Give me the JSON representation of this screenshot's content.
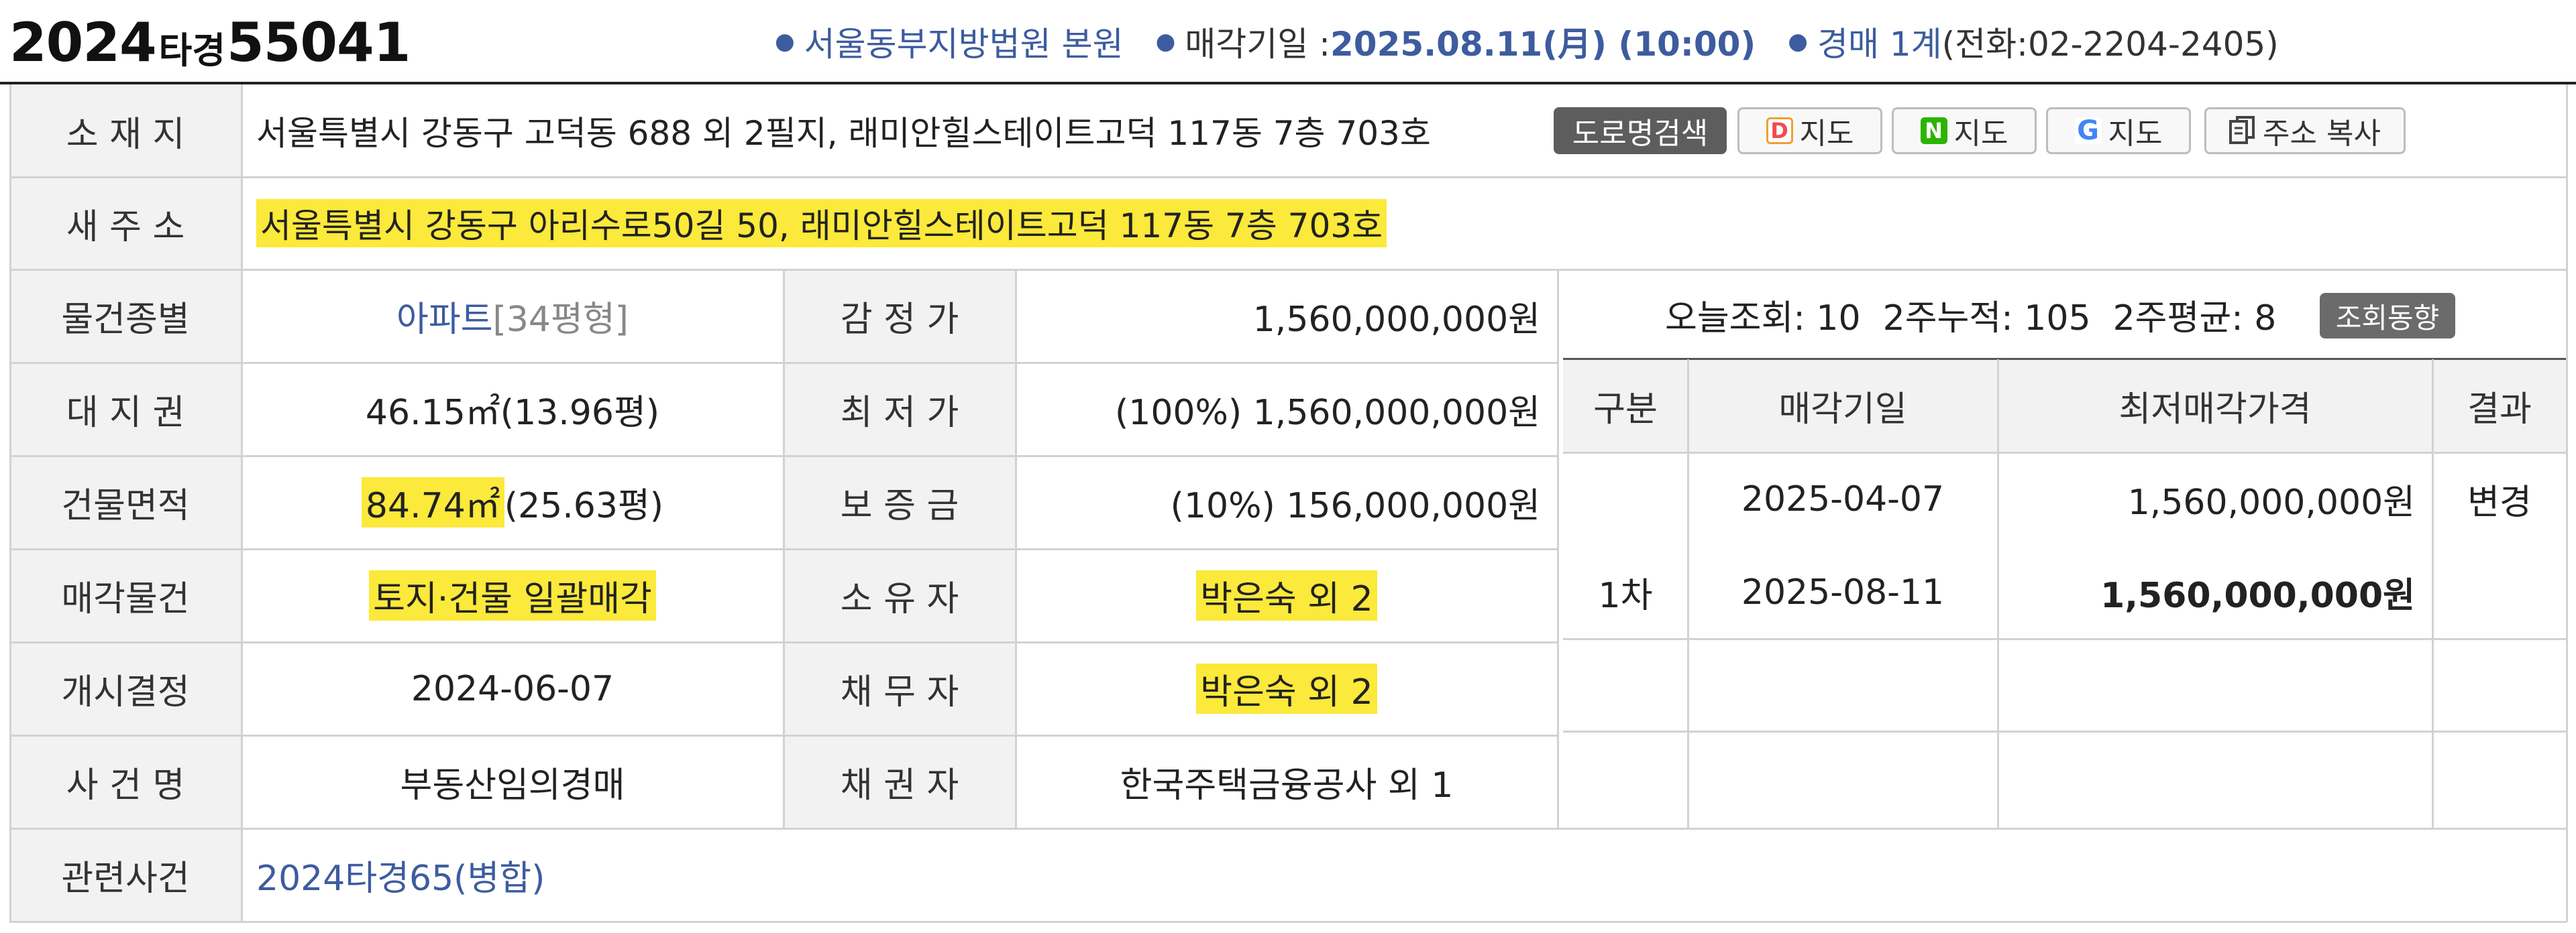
{
  "header": {
    "case_year": "2024",
    "case_type": "타경",
    "case_num": "55041",
    "court": "서울동부지방법원 본원",
    "sale_label": "매각기일 : ",
    "sale_date": "2025.08.11(月) (10:00)",
    "dept": "경매 1계",
    "phone": "(전화:02-2204-2405)"
  },
  "address": {
    "label": "소 재 지",
    "value": "서울특별시 강동구 고덕동 688 외 2필지, 래미안힐스테이트고덕 117동 7층 703호",
    "buttons": {
      "road": "도로명검색",
      "daum_icon": "D",
      "naver_icon": "N",
      "google_icon": "G",
      "map": "지도",
      "copy": "주소 복사"
    }
  },
  "new_address": {
    "label": "새 주 소",
    "value": "서울특별시 강동구 아리수로50길 50, 래미안힐스테이트고덕 117동 7층 703호"
  },
  "details": {
    "type_label": "물건종별",
    "type_value": "아파트",
    "type_size": "[34평형]",
    "land_label": "대 지 권",
    "land_value": "46.15㎡(13.96평)",
    "bldg_label": "건물면적",
    "bldg_value_hl": "84.74㎡",
    "bldg_value_rest": "(25.63평)",
    "sale_obj_label": "매각물건",
    "sale_obj_value": "토지·건물 일괄매각",
    "start_label": "개시결정",
    "start_value": "2024-06-07",
    "case_name_label": "사 건 명",
    "case_name_value": "부동산임의경매",
    "related_label": "관련사건",
    "related_value": "2024타경65(병합)"
  },
  "prices": {
    "appraisal_label": "감 정 가",
    "appraisal_value": "1,560,000,000원",
    "min_label": "최 저 가",
    "min_value": "(100%) 1,560,000,000원",
    "deposit_label": "보 증 금",
    "deposit_value": "(10%) 156,000,000원",
    "owner_label": "소 유 자",
    "owner_value": "박은숙 외 2",
    "debtor_label": "채 무 자",
    "debtor_value": "박은숙 외 2",
    "creditor_label": "채 권 자",
    "creditor_value": "한국주택금융공사 외 1"
  },
  "views": {
    "text": "오늘조회: 10  2주누적: 105  2주평균: 8",
    "button": "조회동향"
  },
  "history": {
    "headers": [
      "구분",
      "매각기일",
      "최저매각가격",
      "결과"
    ],
    "rows": [
      {
        "round": "",
        "date": "2025-04-07",
        "price": "1,560,000,000원",
        "result": "변경"
      },
      {
        "round": "1차",
        "date": "2025-08-11",
        "price": "1,560,000,000원",
        "result": ""
      }
    ]
  }
}
